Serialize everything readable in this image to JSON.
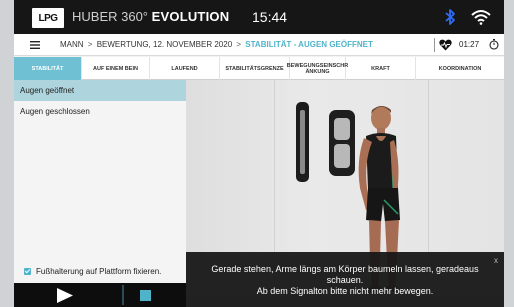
{
  "header": {
    "logo": "LPG",
    "brand_prefix": "HUBER 360°",
    "brand_name": "EVOLUTION",
    "time": "15:44"
  },
  "breadcrumb": {
    "part1": "MANN",
    "part2": "BEWERTUNG, 12. NOVEMBER 2020",
    "active": "STABILITÄT - AUGEN GEÖFFNET",
    "separator": ">"
  },
  "session": {
    "timer": "01:27"
  },
  "tabs": [
    {
      "label": "STABILITÄT",
      "active": true
    },
    {
      "label": "AUF EINEM BEIN",
      "active": false
    },
    {
      "label": "LAUFEND",
      "active": false
    },
    {
      "label": "STABILITÄTSGRENZE",
      "active": false
    },
    {
      "label": "BEWEGUNGSEINSCHR ÄNKUNG",
      "active": false
    },
    {
      "label": "KRAFT",
      "active": false
    },
    {
      "label": "KOORDINATION",
      "active": false
    }
  ],
  "exercises": [
    {
      "label": "Augen geöffnet",
      "selected": true
    },
    {
      "label": "Augen geschlossen",
      "selected": false
    }
  ],
  "fixation": {
    "label": "Fußhalterung auf Plattform fixieren.",
    "checked": true
  },
  "instruction": {
    "close": "x",
    "line1": "Gerade stehen, Arme längs am Körper baumeln lassen, geradeaus",
    "line2": "schauen.",
    "line3": "Ab dem Signalton bitte nicht mehr bewegen."
  },
  "colors": {
    "accent": "#4fb3c9",
    "tab_active": "#6fc0d2",
    "selected_row": "#aed5de",
    "topbar": "#161616",
    "bluetooth": "#2f6df6"
  },
  "icons": [
    "bluetooth-icon",
    "wifi-icon",
    "menu-icon",
    "heart-rate-icon",
    "stopwatch-icon",
    "play-icon",
    "stop-icon"
  ]
}
